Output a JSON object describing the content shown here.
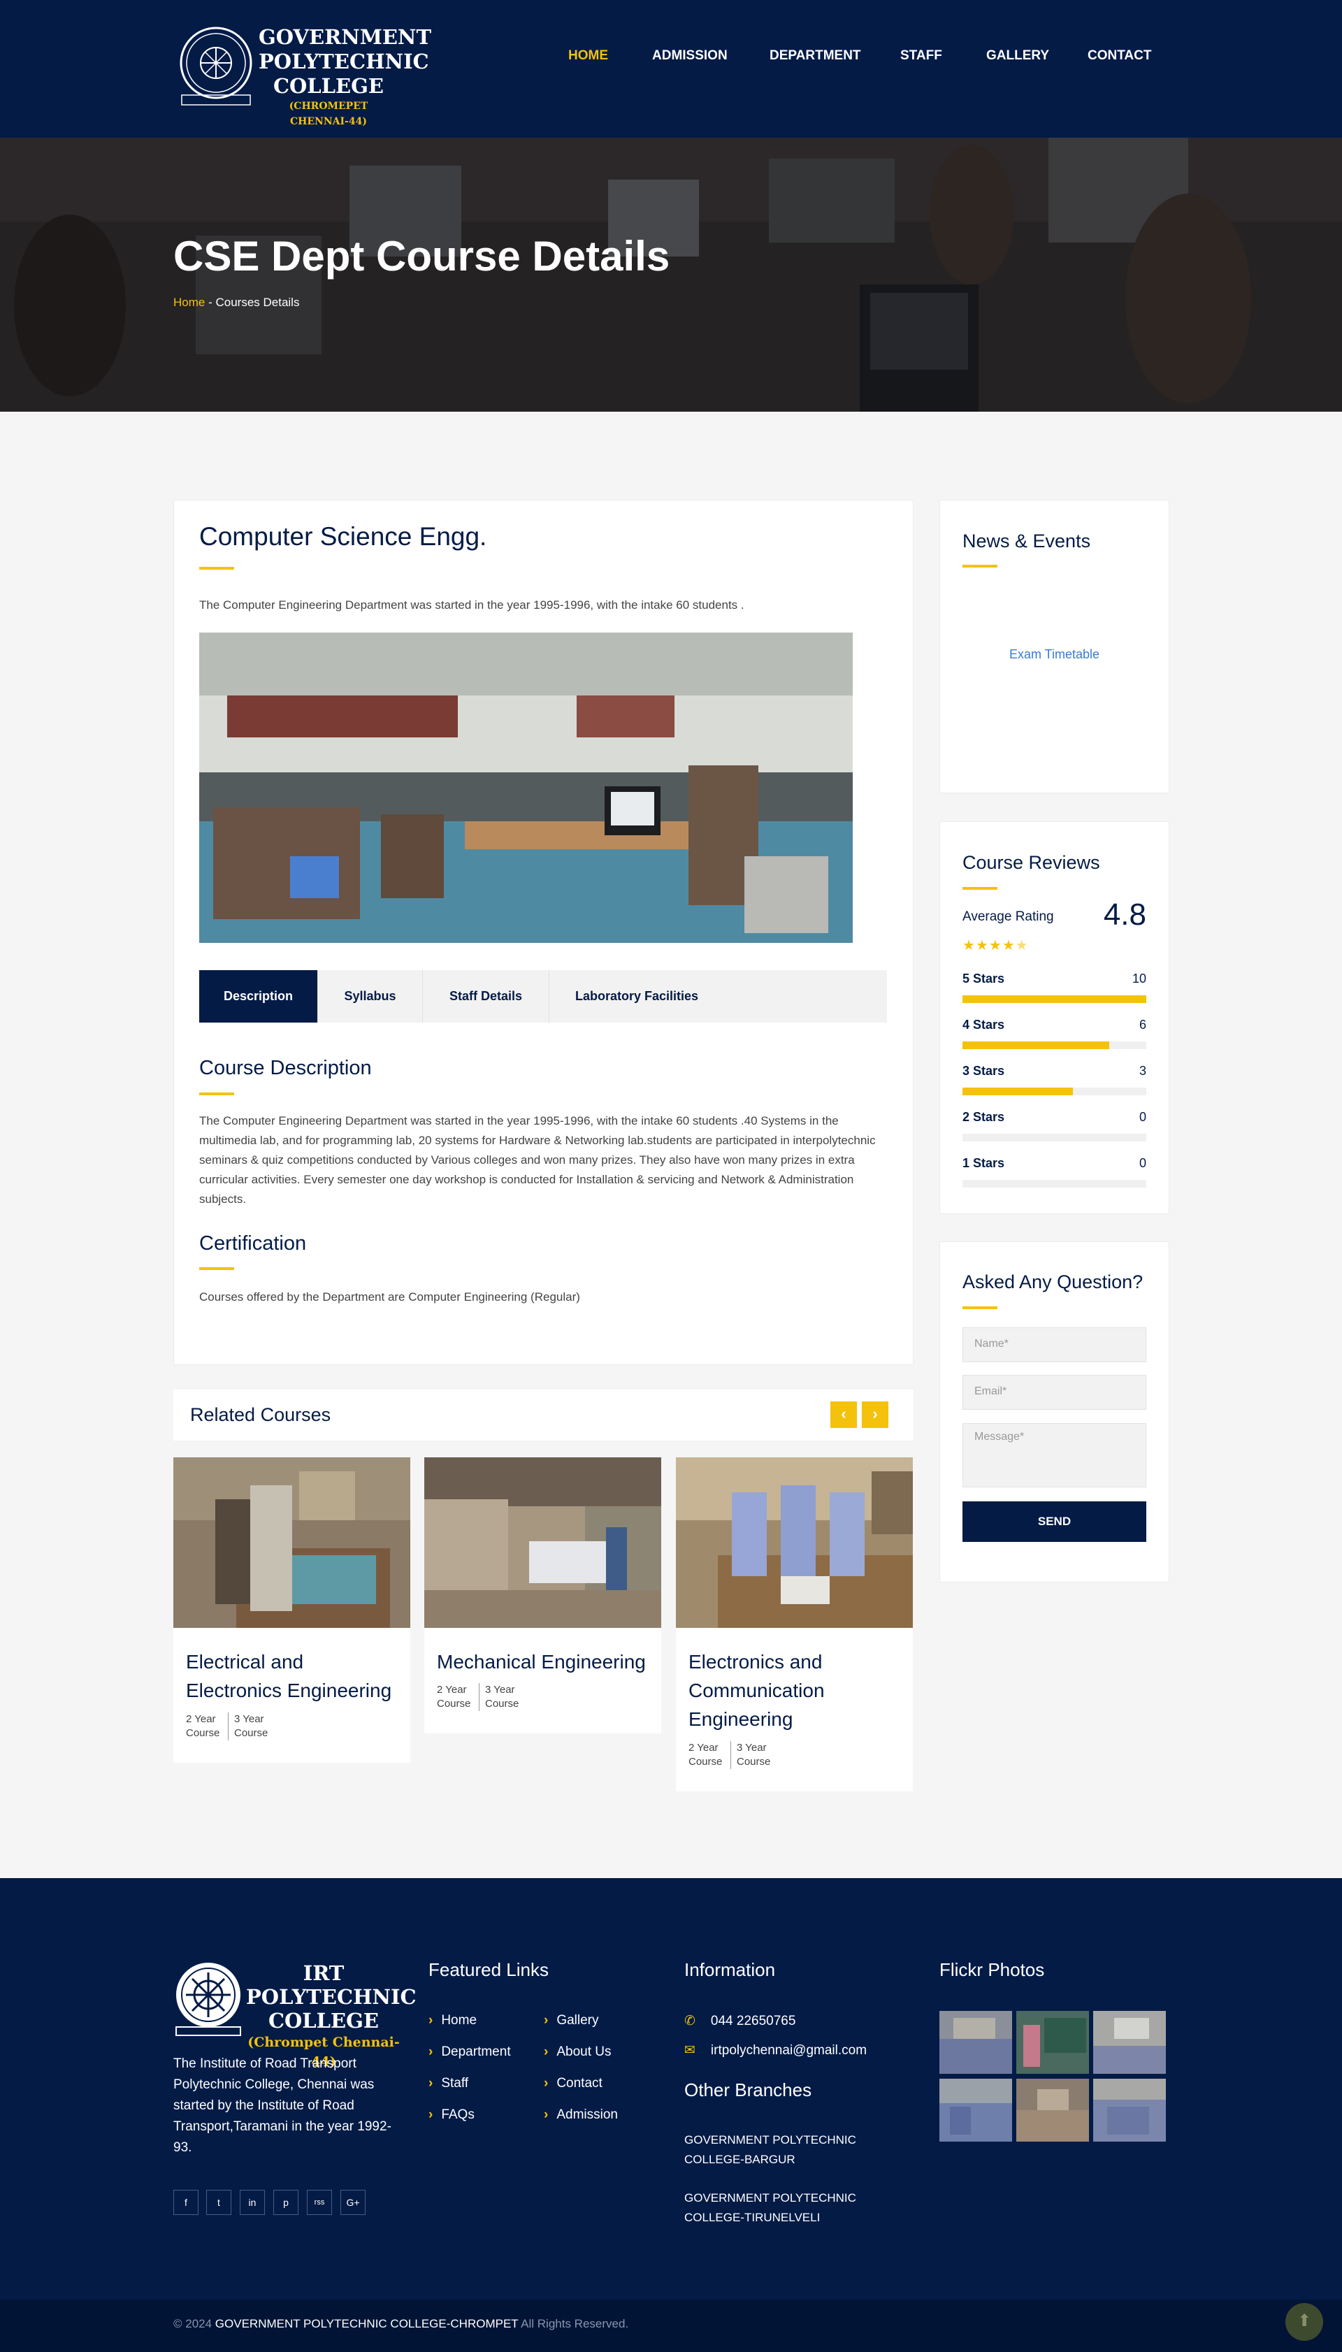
{
  "brand": {
    "logo_line1": "GOVERNMENT",
    "logo_line2": "POLYTECHNIC",
    "logo_line3": "COLLEGE",
    "logo_line4": "(CHROMEPET CHENNAI-44)"
  },
  "nav": {
    "items": [
      "HOME",
      "ADMISSION",
      "DEPARTMENT",
      "STAFF",
      "GALLERY",
      "CONTACT"
    ],
    "active": "HOME"
  },
  "hero": {
    "title": "CSE Dept Course Details",
    "breadcrumb_home": "Home",
    "breadcrumb_sep": " - ",
    "breadcrumb_current": "Courses Details"
  },
  "main": {
    "title": "Computer Science Engg.",
    "intro": "The Computer Engineering Department was started in the year 1995-1996, with the intake 60 students .",
    "tabs": [
      "Description",
      "Syllabus",
      "Staff Details",
      "Laboratory Facilities"
    ],
    "active_tab": "Description",
    "course_description_heading": "Course Description",
    "course_description": "The Computer Engineering Department was started in the year 1995-1996, with the intake 60 students .40 Systems in the multimedia lab, and for programming lab, 20 systems for Hardware & Networking lab.students are participated in interpolytechnic seminars & quiz competitions conducted by Various colleges and won many prizes. They also have won many prizes in extra curricular activities. Every semester one day workshop is conducted for Installation & servicing and Network & Administration subjects.",
    "certification_heading": "Certification",
    "certification_text": "Courses offered by the Department are Computer Engineering (Regular)"
  },
  "related": {
    "heading": "Related Courses",
    "prev_icon": "‹",
    "next_icon": "›",
    "courses": [
      {
        "title": "Electrical and Electronics Engineering",
        "meta1": "2 Year Course",
        "meta2": "3 Year Course"
      },
      {
        "title": "Mechanical Engineering",
        "meta1": "2 Year Course",
        "meta2": "3 Year Course"
      },
      {
        "title": "Electronics and Communication Engineering",
        "meta1": "2 Year Course",
        "meta2": "3 Year Course"
      }
    ]
  },
  "sidebar": {
    "news_heading": "News & Events",
    "news_link": "Exam Timetable",
    "reviews_heading": "Course Reviews",
    "average_label": "Average Rating",
    "average_value": "4.8",
    "star_rating": 4.5,
    "reviews": [
      {
        "label": "5 Stars",
        "count": "10",
        "fraction": 1.0
      },
      {
        "label": "4 Stars",
        "count": "6",
        "fraction": 0.8
      },
      {
        "label": "3 Stars",
        "count": "3",
        "fraction": 0.6
      },
      {
        "label": "2 Stars",
        "count": "0",
        "fraction": 0
      },
      {
        "label": "1 Stars",
        "count": "0",
        "fraction": 0
      }
    ],
    "question_heading": "Asked Any Question?",
    "name_placeholder": "Name*",
    "email_placeholder": "Email*",
    "message_placeholder": "Message*",
    "send_label": "SEND"
  },
  "footer": {
    "logo_line1": "IRT POLYTECHNIC",
    "logo_line2": "COLLEGE",
    "logo_line3": "(Chrompet Chennai-44)",
    "about": "The Institute of Road Transport Polytechnic College, Chennai was started by the Institute of Road Transport,Taramani in the year 1992-93.",
    "social": [
      "f",
      "t",
      "in",
      "p",
      "rss",
      "G+"
    ],
    "featured_heading": "Featured Links",
    "links_col1": [
      "Home",
      "Department",
      "Staff",
      "FAQs"
    ],
    "links_col2": [
      "Gallery",
      "About Us",
      "Contact",
      "Admission"
    ],
    "info_heading": "Information",
    "phone": "044 22650765",
    "email": "irtpolychennai@gmail.com",
    "branches_heading": "Other Branches",
    "branch1": "GOVERNMENT POLYTECHNIC COLLEGE-BARGUR",
    "branch2": "GOVERNMENT POLYTECHNIC COLLEGE-TIRUNELVELI",
    "flickr_heading": "Flickr Photos",
    "copyright_prefix": "© 2024 ",
    "copyright_name": "GOVERNMENT POLYTECHNIC COLLEGE-CHROMPET",
    "copyright_suffix": " All Rights Reserved."
  },
  "colors": {
    "navy": "#041b46",
    "accent": "#f4c20d",
    "link_blue": "#3a7bd5"
  }
}
